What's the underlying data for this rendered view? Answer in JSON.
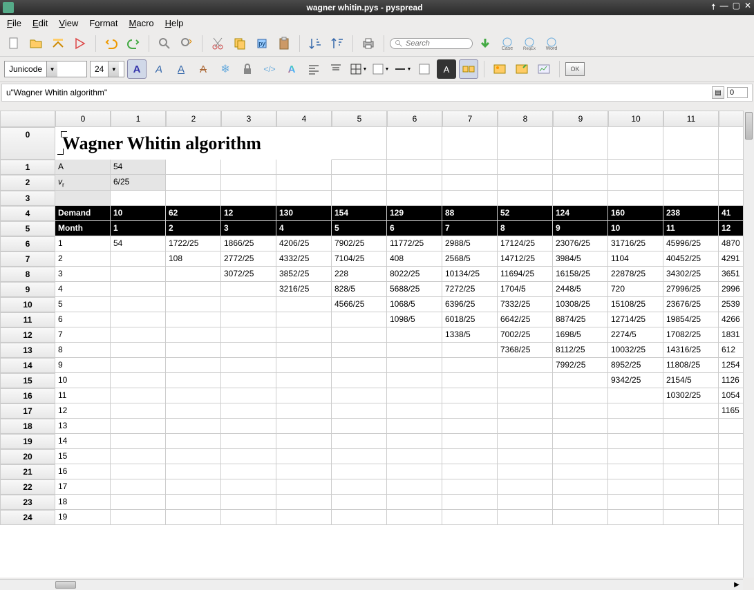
{
  "window": {
    "title": "wagner whitin.pys - pyspread"
  },
  "menu": [
    "File",
    "Edit",
    "View",
    "Format",
    "Macro",
    "Help"
  ],
  "toolbar": {
    "search_placeholder": "Search"
  },
  "format": {
    "font": "Junicode",
    "size": "24"
  },
  "formula": {
    "content": "u\"Wagner Whitin algorithm\"",
    "sheet": "0"
  },
  "columns": [
    "0",
    "1",
    "2",
    "3",
    "4",
    "5",
    "6",
    "7",
    "8",
    "9",
    "10",
    "11"
  ],
  "title_text": "Wagner Whitin algorithm",
  "rows": [
    {
      "hdr": "1",
      "cells": [
        "A",
        "54",
        "",
        "",
        "",
        "",
        "",
        "",
        "",
        "",
        "",
        ""
      ],
      "style": "grey3"
    },
    {
      "hdr": "2",
      "cells": [
        "vᵣ",
        "6/25",
        "",
        "",
        "",
        "",
        "",
        "",
        "",
        "",
        "",
        ""
      ],
      "style": "grey3"
    },
    {
      "hdr": "3",
      "cells": [
        "",
        "",
        "",
        "",
        "",
        "",
        "",
        "",
        "",
        "",
        "",
        ""
      ],
      "style": "grey1"
    },
    {
      "hdr": "4",
      "cells": [
        "Demand",
        "10",
        "62",
        "12",
        "130",
        "154",
        "129",
        "88",
        "52",
        "124",
        "160",
        "238",
        "41"
      ],
      "style": "dark"
    },
    {
      "hdr": "5",
      "cells": [
        "Month",
        "1",
        "2",
        "3",
        "4",
        "5",
        "6",
        "7",
        "8",
        "9",
        "10",
        "11",
        "12"
      ],
      "style": "dark"
    },
    {
      "hdr": "6",
      "cells": [
        "1",
        "54",
        "1722/25",
        "1866/25",
        "4206/25",
        "7902/25",
        "11772/25",
        "2988/5",
        "17124/25",
        "23076/25",
        "31716/25",
        "45996/25",
        "4870"
      ]
    },
    {
      "hdr": "7",
      "cells": [
        "2",
        "",
        "108",
        "2772/25",
        "4332/25",
        "7104/25",
        "408",
        "2568/5",
        "14712/25",
        "3984/5",
        "1104",
        "40452/25",
        "4291"
      ]
    },
    {
      "hdr": "8",
      "cells": [
        "3",
        "",
        "",
        "3072/25",
        "3852/25",
        "228",
        "8022/25",
        "10134/25",
        "11694/25",
        "16158/25",
        "22878/25",
        "34302/25",
        "3651"
      ]
    },
    {
      "hdr": "9",
      "cells": [
        "4",
        "",
        "",
        "",
        "3216/25",
        "828/5",
        "5688/25",
        "7272/25",
        "1704/5",
        "2448/5",
        "720",
        "27996/25",
        "2996"
      ]
    },
    {
      "hdr": "10",
      "cells": [
        "5",
        "",
        "",
        "",
        "",
        "4566/25",
        "1068/5",
        "6396/25",
        "7332/25",
        "10308/25",
        "15108/25",
        "23676/25",
        "2539"
      ]
    },
    {
      "hdr": "11",
      "cells": [
        "6",
        "",
        "",
        "",
        "",
        "",
        "1098/5",
        "6018/25",
        "6642/25",
        "8874/25",
        "12714/25",
        "19854/25",
        "4266"
      ]
    },
    {
      "hdr": "12",
      "cells": [
        "7",
        "",
        "",
        "",
        "",
        "",
        "",
        "1338/5",
        "7002/25",
        "1698/5",
        "2274/5",
        "17082/25",
        "1831"
      ]
    },
    {
      "hdr": "13",
      "cells": [
        "8",
        "",
        "",
        "",
        "",
        "",
        "",
        "",
        "7368/25",
        "8112/25",
        "10032/25",
        "14316/25",
        "612"
      ]
    },
    {
      "hdr": "14",
      "cells": [
        "9",
        "",
        "",
        "",
        "",
        "",
        "",
        "",
        "",
        "7992/25",
        "8952/25",
        "11808/25",
        "1254"
      ]
    },
    {
      "hdr": "15",
      "cells": [
        "10",
        "",
        "",
        "",
        "",
        "",
        "",
        "",
        "",
        "",
        "9342/25",
        "2154/5",
        "1126"
      ]
    },
    {
      "hdr": "16",
      "cells": [
        "11",
        "",
        "",
        "",
        "",
        "",
        "",
        "",
        "",
        "",
        "",
        "10302/25",
        "1054"
      ]
    },
    {
      "hdr": "17",
      "cells": [
        "12",
        "",
        "",
        "",
        "",
        "",
        "",
        "",
        "",
        "",
        "",
        "",
        "1165"
      ]
    },
    {
      "hdr": "18",
      "cells": [
        "13",
        "",
        "",
        "",
        "",
        "",
        "",
        "",
        "",
        "",
        "",
        "",
        ""
      ]
    },
    {
      "hdr": "19",
      "cells": [
        "14",
        "",
        "",
        "",
        "",
        "",
        "",
        "",
        "",
        "",
        "",
        "",
        ""
      ]
    },
    {
      "hdr": "20",
      "cells": [
        "15",
        "",
        "",
        "",
        "",
        "",
        "",
        "",
        "",
        "",
        "",
        "",
        ""
      ]
    },
    {
      "hdr": "21",
      "cells": [
        "16",
        "",
        "",
        "",
        "",
        "",
        "",
        "",
        "",
        "",
        "",
        "",
        ""
      ]
    },
    {
      "hdr": "22",
      "cells": [
        "17",
        "",
        "",
        "",
        "",
        "",
        "",
        "",
        "",
        "",
        "",
        "",
        ""
      ]
    },
    {
      "hdr": "23",
      "cells": [
        "18",
        "",
        "",
        "",
        "",
        "",
        "",
        "",
        "",
        "",
        "",
        "",
        ""
      ]
    },
    {
      "hdr": "24",
      "cells": [
        "19",
        "",
        "",
        "",
        "",
        "",
        "",
        "",
        "",
        "",
        "",
        "",
        ""
      ]
    }
  ],
  "ok_label": "OK"
}
